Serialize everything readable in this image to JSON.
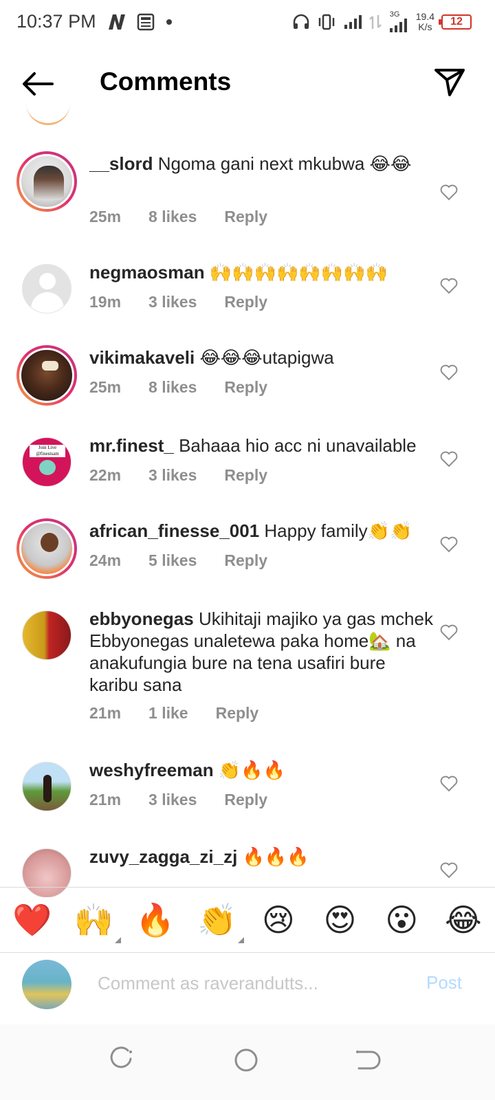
{
  "status_bar": {
    "time": "10:37 PM",
    "net_speed_value": "19.4",
    "net_speed_unit": "K/s",
    "network_type": "3G",
    "battery": "12"
  },
  "header": {
    "title": "Comments"
  },
  "comments": [
    {
      "username": "__slord",
      "text": "Ngoma gani next mkubwa 😂😂",
      "time": "25m",
      "likes": "8 likes",
      "reply": "Reply"
    },
    {
      "username": "negmaosman",
      "text": "🙌🙌🙌🙌🙌🙌🙌🙌",
      "time": "19m",
      "likes": "3 likes",
      "reply": "Reply"
    },
    {
      "username": "vikimakaveli",
      "text": "😂😂😂utapigwa",
      "time": "25m",
      "likes": "8 likes",
      "reply": "Reply"
    },
    {
      "username": "mr.finest_",
      "text": "Bahaaa hio acc ni unavailable",
      "time": "22m",
      "likes": "3 likes",
      "reply": "Reply"
    },
    {
      "username": "african_finesse_001",
      "text": "Happy family👏👏",
      "time": "24m",
      "likes": "5 likes",
      "reply": "Reply"
    },
    {
      "username": "ebbyonegas",
      "text": "Ukihitaji majiko ya gas mchek Ebbyonegas  unaletewa paka home🏡 na anakufungia bure na tena usafiri bure karibu sana",
      "time": "21m",
      "likes": "1 like",
      "reply": "Reply"
    },
    {
      "username": "weshyfreeman",
      "text": "👏🔥🔥",
      "time": "21m",
      "likes": "3 likes",
      "reply": "Reply"
    },
    {
      "username": "zuvy_zagga_zi_zj",
      "text": "🔥🔥🔥",
      "time": "",
      "likes": "",
      "reply": ""
    }
  ],
  "mr_finest_avatar_text": {
    "line1": "Join Live",
    "line2": "@finestsam"
  },
  "emoji_bar": [
    "❤️",
    "🙌",
    "🔥",
    "👏",
    "😢",
    "😍",
    "😮",
    "😂"
  ],
  "composer": {
    "placeholder": "Comment as raverandutts...",
    "post_label": "Post"
  },
  "colors": {
    "accent_post_disabled": "#b3dbff",
    "meta_gray": "#8e8e8e",
    "battery_red": "#d0342c"
  }
}
